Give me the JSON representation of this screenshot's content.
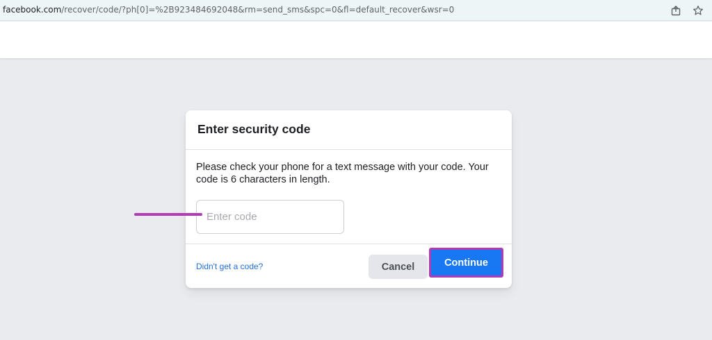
{
  "browser": {
    "url_host": "facebook.com",
    "url_path": "/recover/code/?ph[0]=%2B923484692048&rm=send_sms&spc=0&fl=default_recover&wsr=0",
    "icons": [
      "share-icon",
      "star-icon"
    ]
  },
  "dialog": {
    "title": "Enter security code",
    "message": "Please check your phone for a text message with your code. Your code is 6 characters in length.",
    "code_input": {
      "value": "",
      "placeholder": "Enter code"
    },
    "resend_link": "Didn't get a code?",
    "cancel_label": "Cancel",
    "continue_label": "Continue"
  },
  "colors": {
    "page_bg": "#e9ebee",
    "primary": "#1877f2",
    "link": "#216fdb",
    "annotation": "#b23ab4"
  }
}
